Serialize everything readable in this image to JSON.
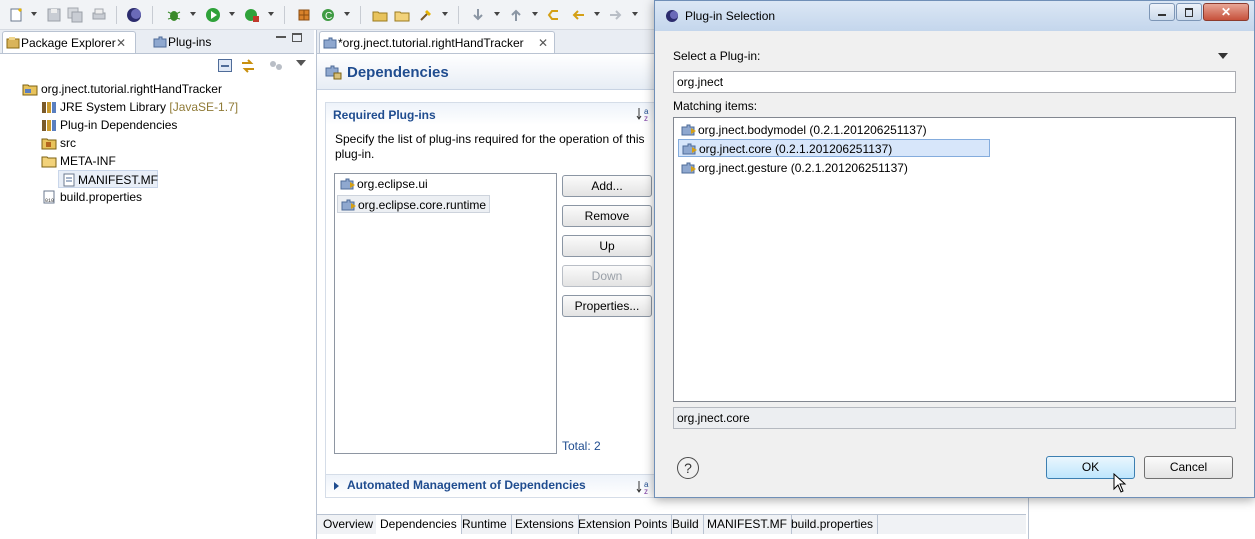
{
  "explorer": {
    "tabs": [
      {
        "label": "Package Explorer"
      },
      {
        "label": "Plug-ins"
      }
    ],
    "tree": [
      {
        "label": "org.jnect.tutorial.rightHandTracker"
      },
      {
        "label": "JRE System Library",
        "suffix": "[JavaSE-1.7]"
      },
      {
        "label": "Plug-in Dependencies"
      },
      {
        "label": "src"
      },
      {
        "label": "META-INF"
      },
      {
        "label": "MANIFEST.MF"
      },
      {
        "label": "build.properties"
      }
    ]
  },
  "editor": {
    "tab_label": "*org.jnect.tutorial.rightHandTracker",
    "page_title": "Dependencies",
    "required_section": {
      "title": "Required Plug-ins",
      "description": "Specify the list of plug-ins required for the operation of this plug-in.",
      "items": [
        {
          "label": "org.eclipse.ui"
        },
        {
          "label": "org.eclipse.core.runtime"
        }
      ],
      "total": "Total: 2",
      "buttons": {
        "add": "Add...",
        "remove": "Remove",
        "up": "Up",
        "down": "Down",
        "properties": "Properties..."
      }
    },
    "automated_section": {
      "title": "Automated Management of Dependencies"
    },
    "bottom_tabs": [
      {
        "label": "Overview"
      },
      {
        "label": "Dependencies"
      },
      {
        "label": "Runtime"
      },
      {
        "label": "Extensions"
      },
      {
        "label": "Extension Points"
      },
      {
        "label": "Build"
      },
      {
        "label": "MANIFEST.MF"
      },
      {
        "label": "build.properties"
      }
    ]
  },
  "dialog": {
    "title": "Plug-in Selection",
    "select_label": "Select a Plug-in:",
    "filter_value": "org.jnect",
    "matching_label": "Matching items:",
    "items": [
      {
        "label": "org.jnect.bodymodel (0.2.1.201206251137)"
      },
      {
        "label": "org.jnect.core (0.2.1.201206251137)"
      },
      {
        "label": "org.jnect.gesture (0.2.1.201206251137)"
      }
    ],
    "selected_index": 1,
    "status_value": "org.jnect.core",
    "ok_label": "OK",
    "cancel_label": "Cancel"
  },
  "colors": {
    "section_title": "#1f4c8f",
    "selection_bg": "#d7e6fa",
    "jre_suffix": "#8f7a36"
  }
}
